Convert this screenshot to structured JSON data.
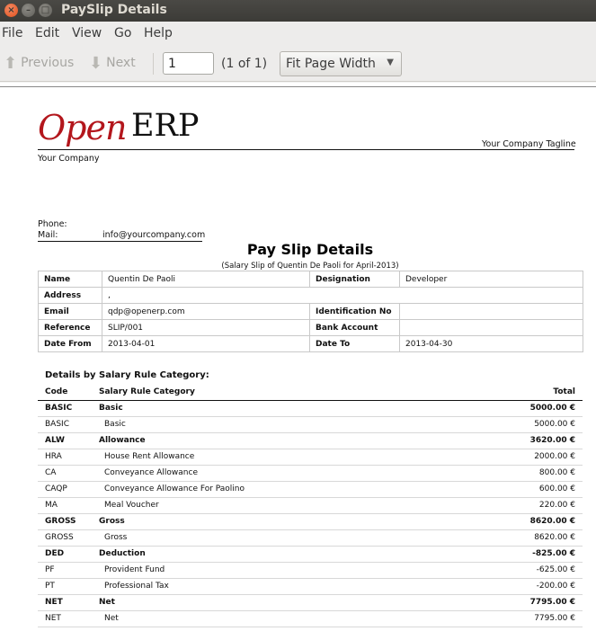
{
  "window": {
    "title": "PaySlip Details"
  },
  "menu": [
    "File",
    "Edit",
    "View",
    "Go",
    "Help"
  ],
  "toolbar": {
    "previous_label": "Previous",
    "next_label": "Next",
    "page_value": "1",
    "page_count": "(1 of 1)",
    "zoom_value": "Fit Page Width"
  },
  "doc": {
    "logo_open": "Open",
    "logo_erp": "ERP",
    "tagline": "Your Company Tagline",
    "company": "Your Company",
    "phone_label": "Phone:",
    "mail_label": "Mail:",
    "mail_value": "info@yourcompany.com",
    "title": "Pay Slip Details",
    "subtitle": "(Salary Slip of Quentin De Paoli for April-2013)",
    "info": {
      "name_label": "Name",
      "name_value": "Quentin De Paoli",
      "designation_label": "Designation",
      "designation_value": "Developer",
      "address_label": "Address",
      "address_value": ",",
      "email_label": "Email",
      "email_value": "qdp@openerp.com",
      "idno_label": "Identification No",
      "idno_value": "",
      "reference_label": "Reference",
      "reference_value": "SLIP/001",
      "bank_label": "Bank Account",
      "bank_value": "",
      "datefrom_label": "Date From",
      "datefrom_value": "2013-04-01",
      "dateto_label": "Date To",
      "dateto_value": "2013-04-30"
    },
    "section_heading": "Details by Salary Rule Category:",
    "columns": {
      "code": "Code",
      "category": "Salary Rule Category",
      "total": "Total"
    },
    "rows": [
      {
        "code": "BASIC",
        "name": "Basic",
        "total": "5000.00 €",
        "bold": true
      },
      {
        "code": "BASIC",
        "name": "Basic",
        "total": "5000.00 €",
        "bold": false
      },
      {
        "code": "ALW",
        "name": "Allowance",
        "total": "3620.00 €",
        "bold": true
      },
      {
        "code": "HRA",
        "name": "House Rent Allowance",
        "total": "2000.00 €",
        "bold": false
      },
      {
        "code": "CA",
        "name": "Conveyance Allowance",
        "total": "800.00 €",
        "bold": false
      },
      {
        "code": "CAQP",
        "name": "Conveyance Allowance For Paolino",
        "total": "600.00 €",
        "bold": false
      },
      {
        "code": "MA",
        "name": "Meal Voucher",
        "total": "220.00 €",
        "bold": false
      },
      {
        "code": "GROSS",
        "name": "Gross",
        "total": "8620.00 €",
        "bold": true
      },
      {
        "code": "GROSS",
        "name": "Gross",
        "total": "8620.00 €",
        "bold": false
      },
      {
        "code": "DED",
        "name": "Deduction",
        "total": "-825.00 €",
        "bold": true
      },
      {
        "code": "PF",
        "name": "Provident Fund",
        "total": "-625.00 €",
        "bold": false
      },
      {
        "code": "PT",
        "name": "Professional Tax",
        "total": "-200.00 €",
        "bold": false
      },
      {
        "code": "NET",
        "name": "Net",
        "total": "7795.00 €",
        "bold": true
      },
      {
        "code": "NET",
        "name": "Net",
        "total": "7795.00 €",
        "bold": false
      }
    ]
  }
}
